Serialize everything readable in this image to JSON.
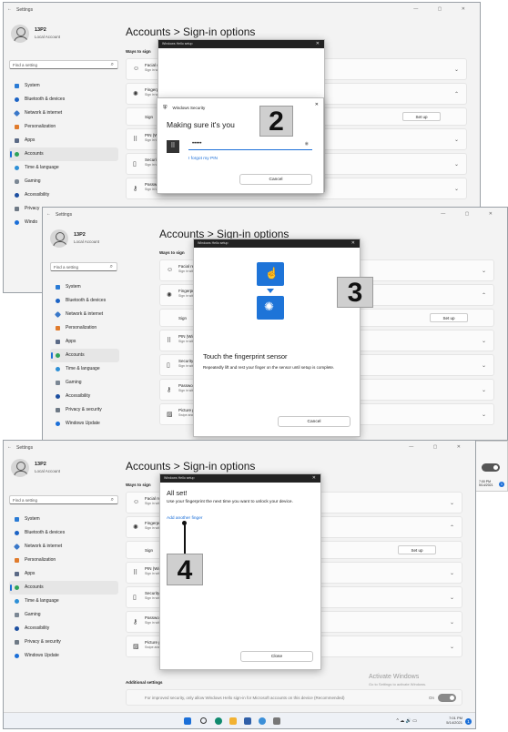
{
  "app": {
    "title": "Settings",
    "back": "←",
    "window_controls": "— ▢ ✕"
  },
  "profile": {
    "name": "13P2",
    "type": "Local Account"
  },
  "search": {
    "placeholder": "Find a setting"
  },
  "nav": [
    "System",
    "Bluetooth & devices",
    "Network & internet",
    "Personalization",
    "Apps",
    "Accounts",
    "Time & language",
    "Gaming",
    "Accessibility",
    "Privacy & security",
    "Windows Update"
  ],
  "nav_short": {
    "privacy": "Privacy",
    "update": "Windo"
  },
  "page": {
    "title": "Accounts  >  Sign-in options",
    "ways_label": "Ways to sign in",
    "ways_label_cut": "Ways to sign"
  },
  "rows": {
    "face": {
      "label": "Facial recognition (Windows Hello)",
      "sub": "Sign in with your camera (Recommended)"
    },
    "finger": {
      "label": "Fingerprint recognition (Windows Hello)",
      "sub": "Sign in with your fingerprint scanner (Recommended)"
    },
    "sign": "Sign",
    "setup": "Set up",
    "pin": {
      "label": "PIN (Windows Hello)",
      "sub": "Sign in with a PIN (Recommended)"
    },
    "security_key": {
      "label": "Security key",
      "sub": "Sign in with a physical security key"
    },
    "password": {
      "label": "Password",
      "sub": "Sign in with your account's password"
    },
    "picture": {
      "label": "Picture password",
      "sub": "Swipe and tap your favorite photo to unlock your device"
    }
  },
  "hello_dialog": {
    "title": "Windows Hello setup",
    "close": "✕"
  },
  "security_dialog": {
    "header": "Windows Security",
    "title": "Making sure it's you",
    "pin_value": "•••••",
    "forgot": "I forgot my PIN",
    "cancel": "Cancel"
  },
  "fingerprint_dialog": {
    "title": "Touch the fingerprint sensor",
    "body": "Repeatedly lift and rest your finger on the sensor until setup is complete.",
    "cancel": "Cancel"
  },
  "done_dialog": {
    "title": "All set!",
    "body": "Use your fingerprint the next time you want to unlock your device.",
    "add_finger": "Add another finger",
    "close": "Close"
  },
  "callouts": {
    "step2": "2",
    "step3": "3",
    "step4": "4"
  },
  "additional": {
    "heading": "Additional settings",
    "text": "For improved security, only allow Windows Hello sign-in for Microsoft accounts on this device (Recommended)",
    "toggle": "On"
  },
  "watermark": {
    "line1": "Activate Windows",
    "line2": "Go to Settings to activate Windows."
  },
  "taskbar": {
    "time": "7:01 PM",
    "date": "5/14/2021",
    "peek_time": "7:00 PM",
    "peek_date": "5/14/2021",
    "tray_icons": "^  ☁  🔊  ▭",
    "badge": "1"
  },
  "colors": {
    "accent": "#1b6fd8",
    "callout_bg": "#cfcfcf",
    "dialog_dark": "#222222",
    "fingerprint_tile": "#1e74d8"
  }
}
